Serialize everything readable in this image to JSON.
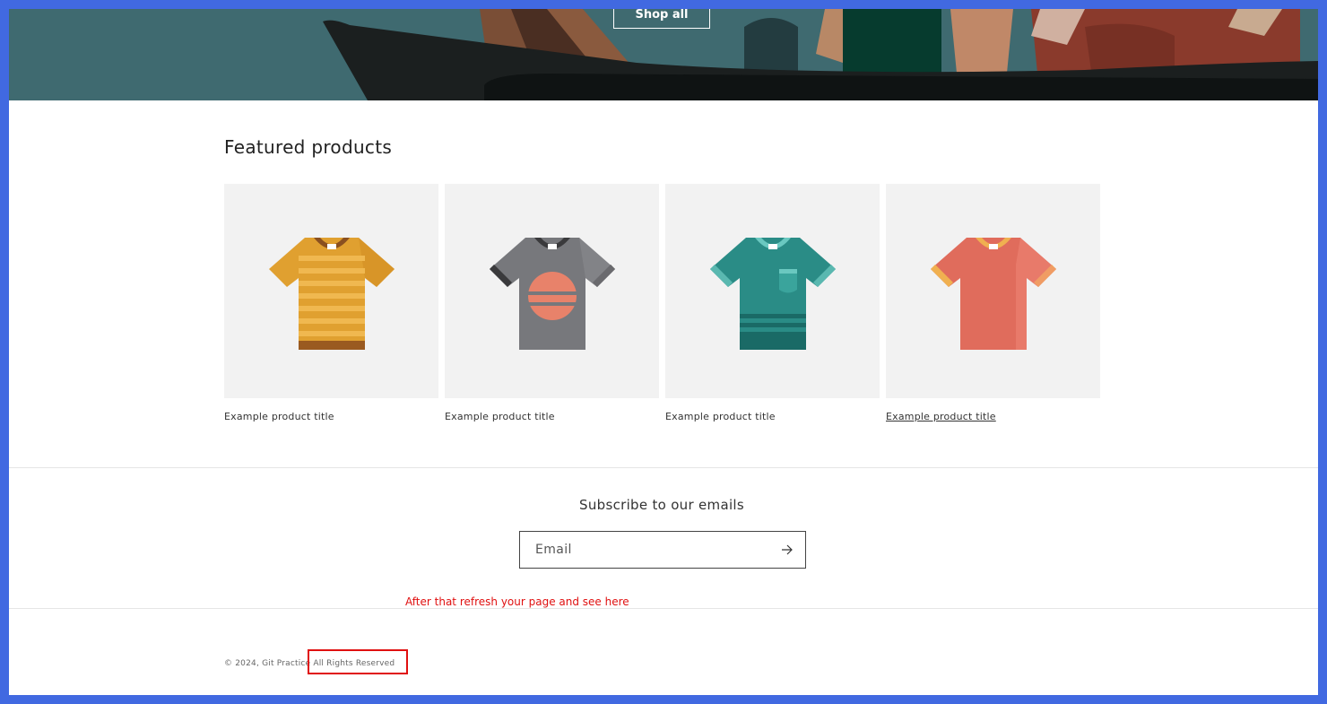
{
  "hero": {
    "button_label": "Shop all"
  },
  "featured": {
    "title": "Featured products",
    "products": [
      {
        "title": "Example product title",
        "shirt_color": "#e0a030",
        "image": "striped-yellow-tshirt-icon"
      },
      {
        "title": "Example product title",
        "shirt_color": "#77787c",
        "image": "gray-sunset-tshirt-icon"
      },
      {
        "title": "Example product title",
        "shirt_color": "#2a8c86",
        "image": "teal-pocket-tshirt-icon"
      },
      {
        "title": "Example product title",
        "shirt_color": "#e06c5c",
        "image": "coral-tshirt-icon"
      }
    ]
  },
  "subscribe": {
    "title": "Subscribe to our emails",
    "email_placeholder": "Email",
    "submit_icon": "arrow-right-icon"
  },
  "annotation": {
    "text": "After that refresh your page and see here",
    "color": "#e01010"
  },
  "footer": {
    "copyright": "© 2024, Git Practice All Rights Reserved"
  },
  "colors": {
    "frame_border": "#4169e1",
    "hero_background": "#3f6a70",
    "product_tile": "#f2f2f2"
  }
}
